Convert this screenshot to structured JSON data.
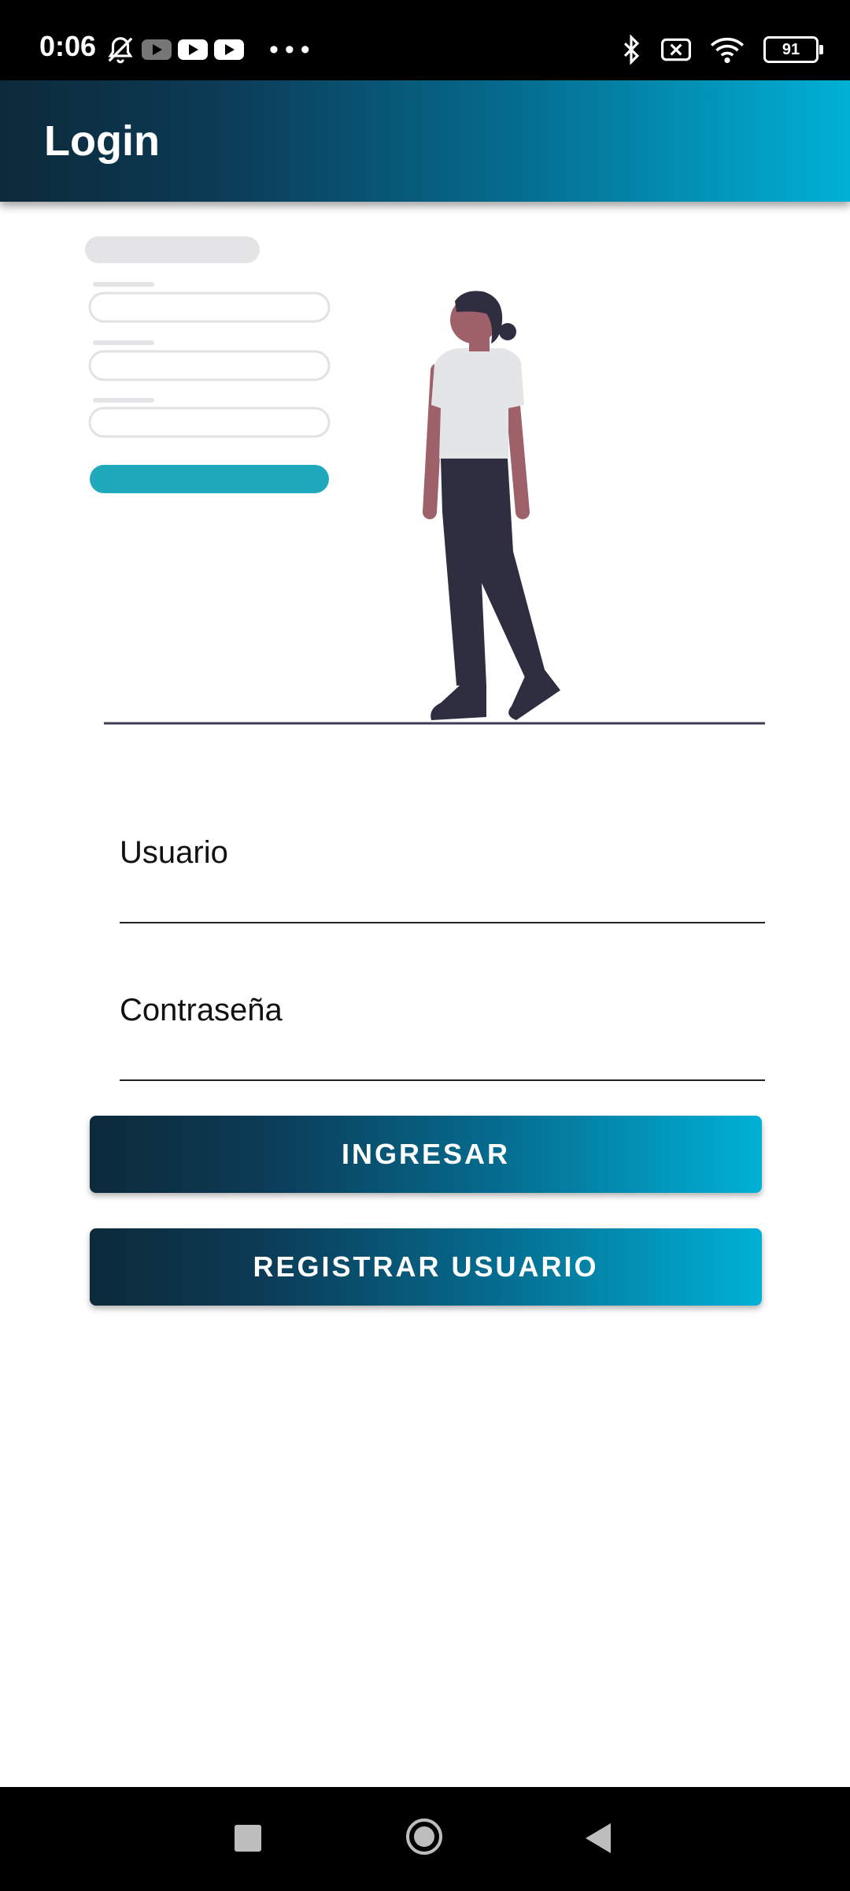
{
  "status_bar": {
    "time": "0:06",
    "battery": "91",
    "icons": [
      "notifications-off-icon",
      "youtube-icon",
      "youtube-icon",
      "youtube-icon",
      "more-icon",
      "bluetooth-icon",
      "sim-off-icon",
      "wifi-icon",
      "battery-icon"
    ]
  },
  "app_bar": {
    "title": "Login"
  },
  "form": {
    "username_placeholder": "Usuario",
    "password_placeholder": "Contraseña",
    "login_button": "INGRESAR",
    "register_button": "REGISTRAR USUARIO"
  },
  "colors": {
    "gradient_start": "#0c2a3a",
    "gradient_end": "#00b1d6",
    "illustration_accent": "#1fa9bd",
    "illustration_dark": "#2f2e41",
    "illustration_skin": "#9e616a"
  },
  "nav_bar": {
    "icons": [
      "recents-icon",
      "home-icon",
      "back-icon"
    ]
  }
}
